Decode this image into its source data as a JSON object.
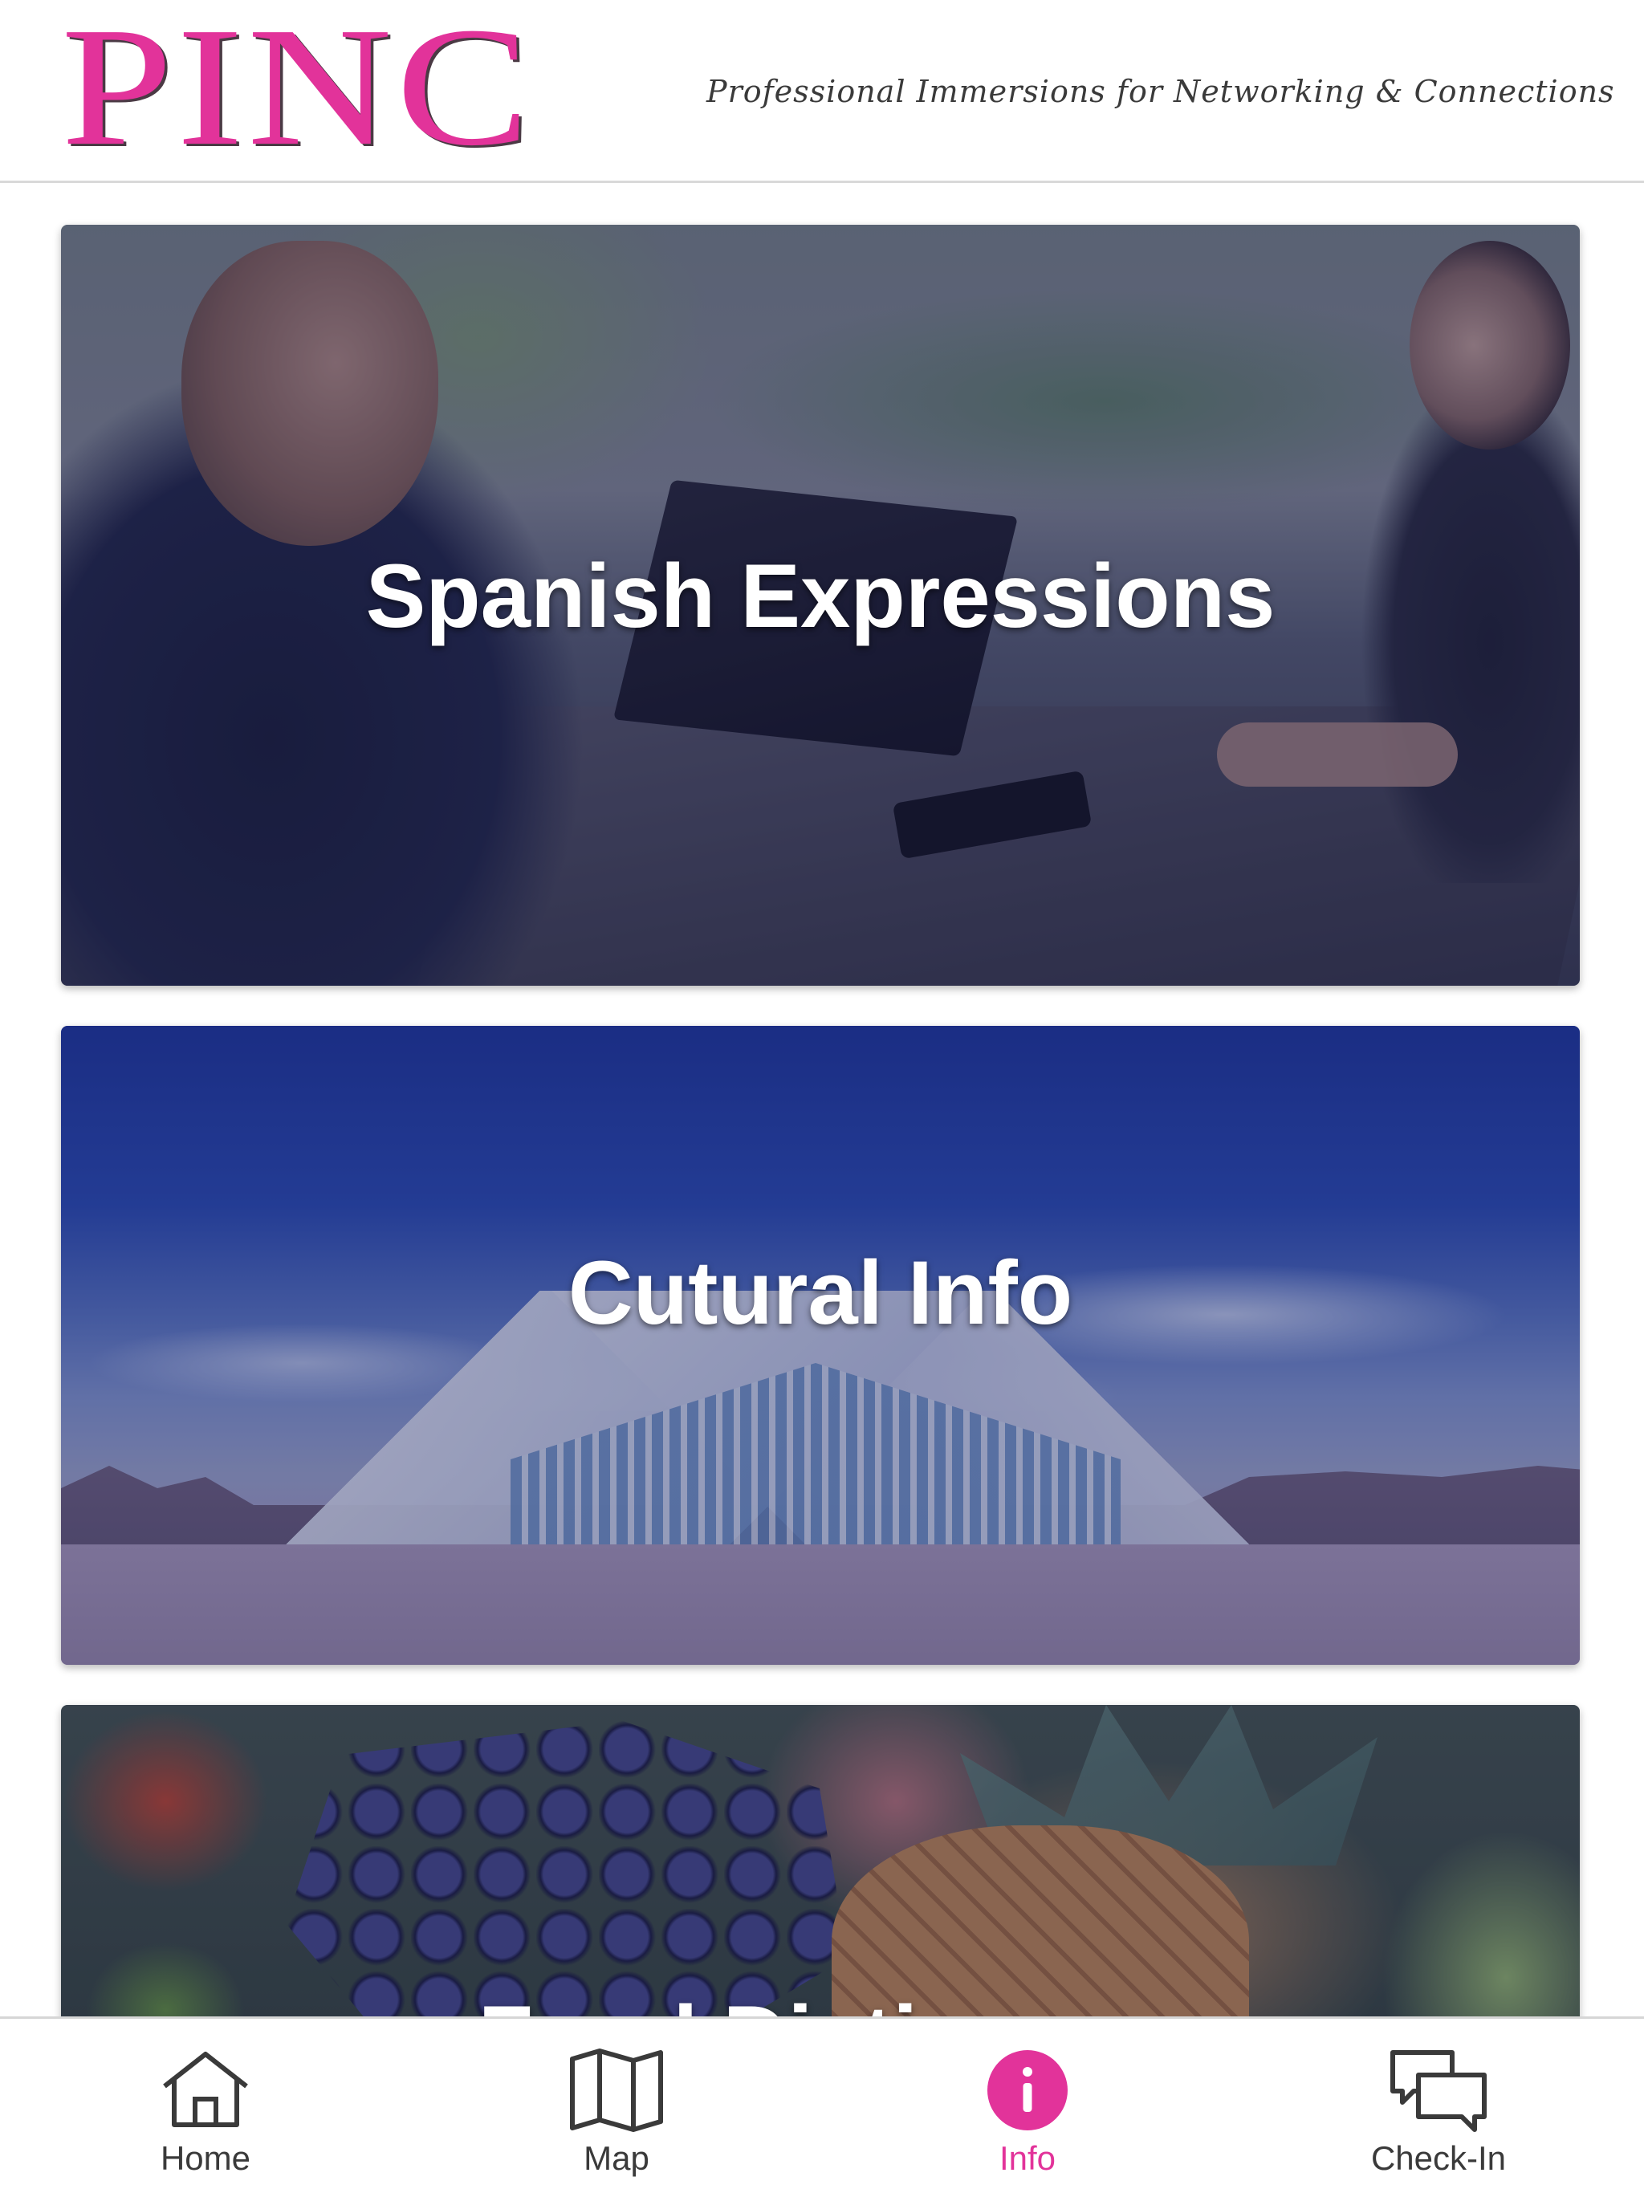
{
  "header": {
    "logo_text": "PINC",
    "tagline": "Professional Immersions for Networking & Connections"
  },
  "cards": [
    {
      "title": "Spanish Expressions"
    },
    {
      "title": "Cutural Info"
    },
    {
      "title": "Food Dictionary"
    }
  ],
  "bottom_nav": {
    "items": [
      {
        "label": "Home",
        "icon": "home-icon",
        "active": false
      },
      {
        "label": "Map",
        "icon": "map-icon",
        "active": false
      },
      {
        "label": "Info",
        "icon": "info-icon",
        "active": true
      },
      {
        "label": "Check-In",
        "icon": "chat-bubbles-icon",
        "active": false
      }
    ]
  },
  "colors": {
    "brand_pink": "#e2339a",
    "nav_text": "#3a3a3a",
    "card_overlay": "#141850"
  }
}
